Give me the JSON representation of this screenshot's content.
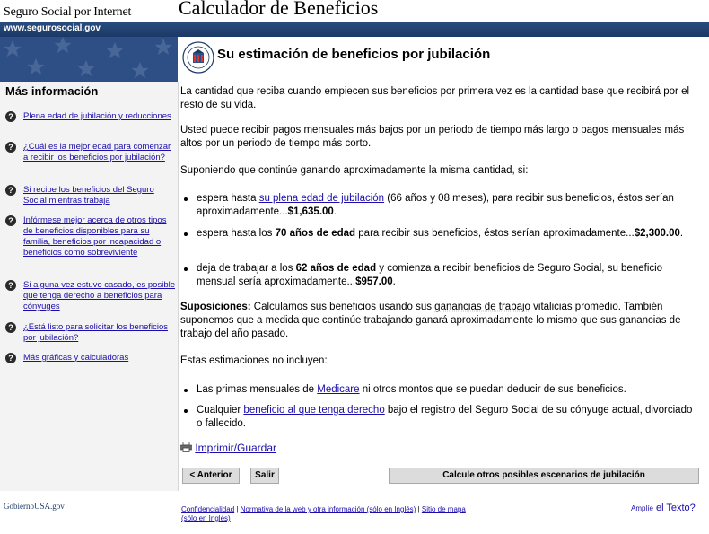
{
  "header": {
    "site_name": "Seguro Social por Internet",
    "app_title": "Calculador de Beneficios",
    "url": "www.segurosocial.gov"
  },
  "sidebar": {
    "heading": "Más información",
    "items": [
      {
        "label": "Plena edad de jubilación y reducciones"
      },
      {
        "label": "¿Cuál es la mejor edad para comenzar a recibir los beneficios por jubilación?"
      },
      {
        "label": "Si recibe los beneficios del Seguro Social mientras trabaja"
      },
      {
        "label": "Infórmese mejor acerca de otros tipos de beneficios disponibles para su familia, beneficios por incapacidad o beneficios como sobreviviente"
      },
      {
        "label": "Si alguna vez estuvo casado, es posible que tenga derecho a beneficios para cónyuges"
      },
      {
        "label": "¿Está listo para solicitar los beneficios por jubilación?"
      },
      {
        "label": "Más gráficas y calculadoras"
      }
    ]
  },
  "main": {
    "title": "Su estimación de beneficios por jubilación",
    "p1": "La cantidad que reciba cuando empiecen sus beneficios por primera vez es la cantidad base que recibirá por el resto de su vida.",
    "p2": "Usted puede recibir pagos mensuales más bajos por un periodo de tiempo más largo o pagos mensuales más altos por un periodo de tiempo más corto.",
    "p3": "Suponiendo que continúe ganando aproximadamente la misma cantidad, si:",
    "b1_pre": "espera hasta ",
    "b1_link": "su plena edad de jubilación",
    "b1_mid": " (66 años y 08 meses), para recibir sus beneficios, éstos serían aproximadamente...",
    "b1_amount": "$1,635.00",
    "b1_end": ".",
    "b2_pre": "espera hasta los ",
    "b2_age": "70 años de edad",
    "b2_mid": " para recibir sus beneficios, éstos serían aproximadamente...",
    "b2_amount": "$2,300.00",
    "b2_end": ".",
    "b3_pre": "deja de trabajar a los ",
    "b3_age": "62 años de edad",
    "b3_mid": " y comienza a recibir beneficios de Seguro Social, su beneficio mensual sería aproximadamente...",
    "b3_amount": "$957.00",
    "b3_end": ".",
    "supp_label": "Suposiciones:",
    "supp_pre": " Calculamos sus beneficios usando sus ",
    "supp_link": "ganancias de trabajo",
    "supp_post": " vitalicias promedio. También suponemos que a medida que continúe trabajando ganará aproximadamente lo mismo que sus ganancias de trabajo del año pasado.",
    "p4": "Estas estimaciones no incluyen:",
    "e1_pre": "Las primas mensuales de ",
    "e1_link": "Medicare",
    "e1_post": " ni otros montos que se puedan deducir de sus beneficios.",
    "e2_pre": "Cualquier ",
    "e2_link": "beneficio al que tenga derecho",
    "e2_post": " bajo el registro del Seguro Social de su cónyuge actual, divorciado o fallecido.",
    "print_label": "Imprimir/Guardar"
  },
  "buttons": {
    "back": "< Anterior",
    "exit": "Salir",
    "calc": "Calcule otros posibles escenarios de jubilación"
  },
  "footer": {
    "logo_text": "GobiernoUSA.gov",
    "link1": "Confidencialidad",
    "link2": "Normativa de la web y otra información (sólo en Inglés)",
    "link3": "Sitio de mapa (sólo en Inglés)",
    "sep": " | ",
    "zoom_small": "Amplíe",
    "zoom_link": "el Texto?"
  }
}
